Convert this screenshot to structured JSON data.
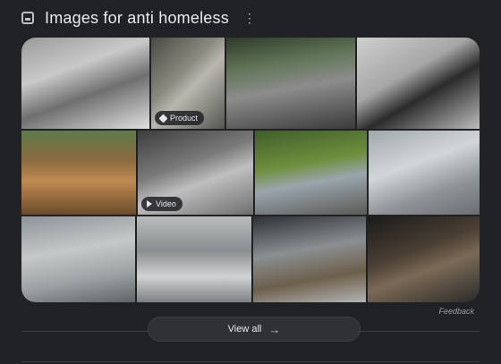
{
  "header": {
    "title": "Images for anti homeless",
    "icon": "image-icon",
    "menu_icon": "more-vert-icon"
  },
  "tiles": [
    {
      "name": "tile-spikes-window",
      "badge": "",
      "bg": "linear-gradient(160deg,#9a9a9a 0%,#c9c9c9 35%,#6f6f6f 60%,#e0e0e0 100%)"
    },
    {
      "name": "tile-grate-bench",
      "badge": "Product",
      "bg": "linear-gradient(135deg,#4a4a45 0%,#8a8a80 40%,#b8b8b0 55%,#555550 100%)"
    },
    {
      "name": "tile-studded-pavement",
      "badge": "",
      "bg": "linear-gradient(170deg,#2e3a2a 0%,#607558 30%,#8c8c8c 55%,#3a3a3a 100%)"
    },
    {
      "name": "tile-curved-bench",
      "badge": "",
      "bg": "linear-gradient(150deg,#cfcfcf 0%,#a6a6a6 40%,#2b2b2b 60%,#bdbdbd 100%)"
    },
    {
      "name": "tile-wooden-bench",
      "badge": "",
      "bg": "linear-gradient(180deg,#5e7b4a 0%,#8a6a3f 35%,#c08a52 60%,#6a4b2a 100%)"
    },
    {
      "name": "tile-metal-grate-car",
      "badge": "Video",
      "bg": "linear-gradient(160deg,#3d3d3d 0%,#7a7a7a 40%,#bfbfbf 60%,#6e6e6e 100%)"
    },
    {
      "name": "tile-planter-bench",
      "badge": "",
      "bg": "linear-gradient(170deg,#3f5e2a 0%,#6f8f3e 40%,#9aa5ad 60%,#5a5a55 100%)"
    },
    {
      "name": "tile-wall-spikes",
      "badge": "",
      "bg": "linear-gradient(160deg,#a0a8ab 0%,#d2d6d8 40%,#8d9396 70%,#6a6e70 100%)"
    },
    {
      "name": "tile-stone-seats",
      "badge": "",
      "bg": "linear-gradient(170deg,#8e9396 0%,#c4c8c9 40%,#9da2a4 70%,#5f6466 100%)"
    },
    {
      "name": "tile-divided-bench",
      "badge": "",
      "bg": "linear-gradient(180deg,#b9bcbd 0%,#8a8d8f 40%,#d0d2d3 70%,#7d8082 100%)"
    },
    {
      "name": "tile-studded-ledge",
      "badge": "",
      "bg": "linear-gradient(170deg,#2e3133 0%,#8b8f91 40%,#6d5f4c 70%,#b3b5b5 100%)"
    },
    {
      "name": "tile-underpass-sleepers",
      "badge": "",
      "bg": "linear-gradient(160deg,#1a1a1a 0%,#4a3f33 40%,#7b6a55 60%,#2a2a2a 100%)"
    }
  ],
  "feedback": "Feedback",
  "view_all": {
    "label": "View all",
    "icon": "arrow-right-icon"
  }
}
